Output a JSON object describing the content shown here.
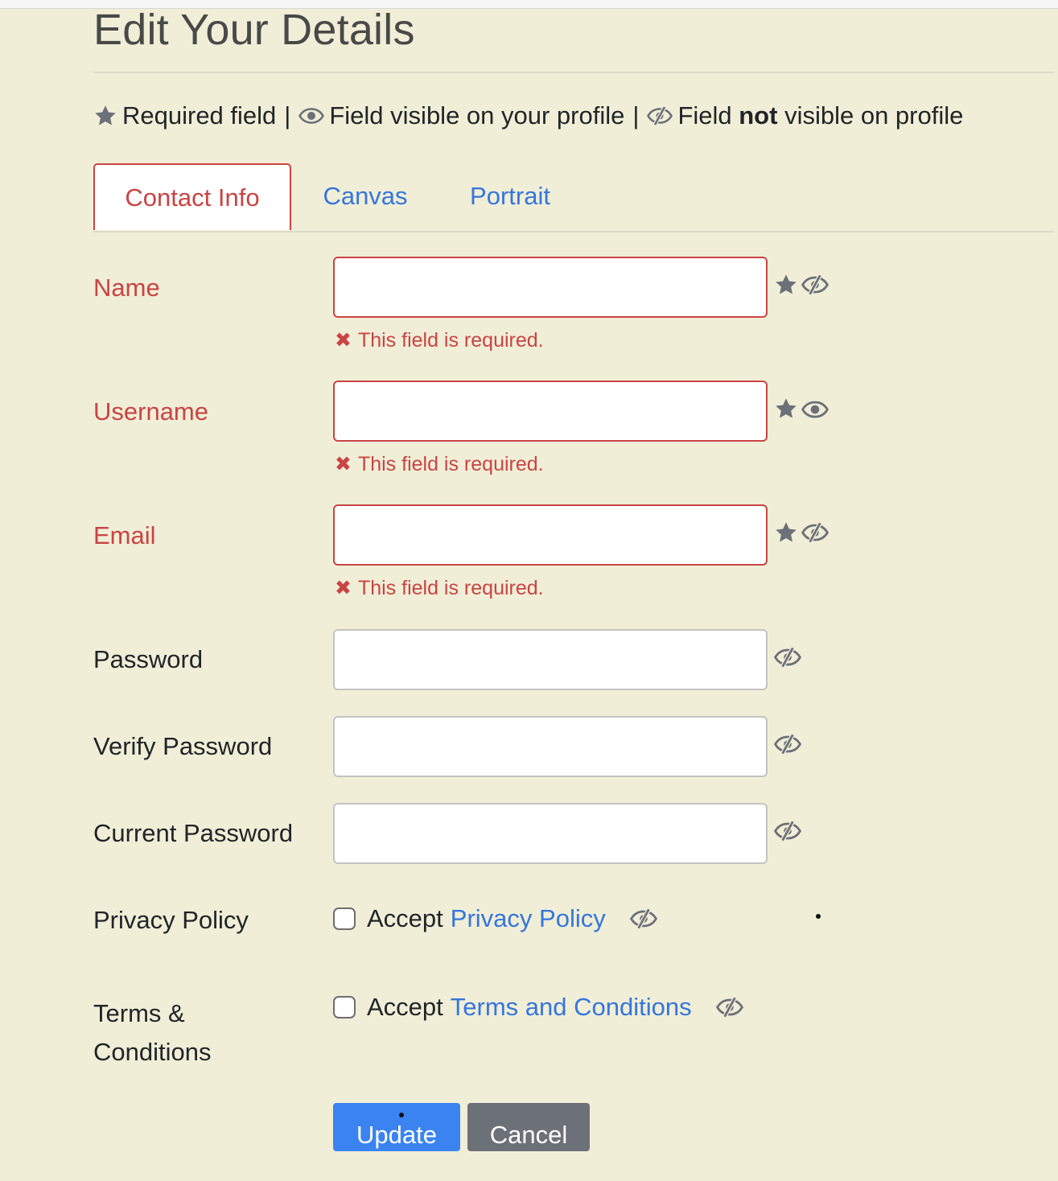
{
  "page": {
    "title": "Edit Your Details"
  },
  "legend": {
    "required": "Required field",
    "visible": "Field visible on your profile",
    "not_visible_pre": "Field ",
    "not_visible_bold": "not",
    "not_visible_post": " visible on profile",
    "separator": "|"
  },
  "tabs": [
    {
      "label": "Contact Info",
      "active": true
    },
    {
      "label": "Canvas",
      "active": false
    },
    {
      "label": "Portrait",
      "active": false
    }
  ],
  "fields": {
    "name": {
      "label": "Name",
      "value": "",
      "error": "This field is required.",
      "required": true,
      "visibility": "hidden"
    },
    "username": {
      "label": "Username",
      "value": "",
      "error": "This field is required.",
      "required": true,
      "visibility": "visible"
    },
    "email": {
      "label": "Email",
      "value": "",
      "error": "This field is required.",
      "required": true,
      "visibility": "hidden"
    },
    "password": {
      "label": "Password",
      "value": "",
      "visibility": "hidden"
    },
    "verify_password": {
      "label": "Verify Password",
      "value": "",
      "visibility": "hidden"
    },
    "current_password": {
      "label": "Current Password",
      "value": "",
      "visibility": "hidden"
    }
  },
  "privacy": {
    "label": "Privacy Policy",
    "accept": "Accept",
    "link": "Privacy Policy",
    "checked": false
  },
  "terms": {
    "label_line1": "Terms &",
    "label_line2": "Conditions",
    "accept": "Accept",
    "link": "Terms and Conditions",
    "checked": false
  },
  "buttons": {
    "update": "Update",
    "cancel": "Cancel"
  },
  "error_glyph": "✖",
  "colors": {
    "background": "#f1eed7",
    "error": "#c94444",
    "link": "#3476dd",
    "primary_button": "#3a83f1",
    "secondary_button": "#6c7178",
    "icon": "#6b7079"
  }
}
